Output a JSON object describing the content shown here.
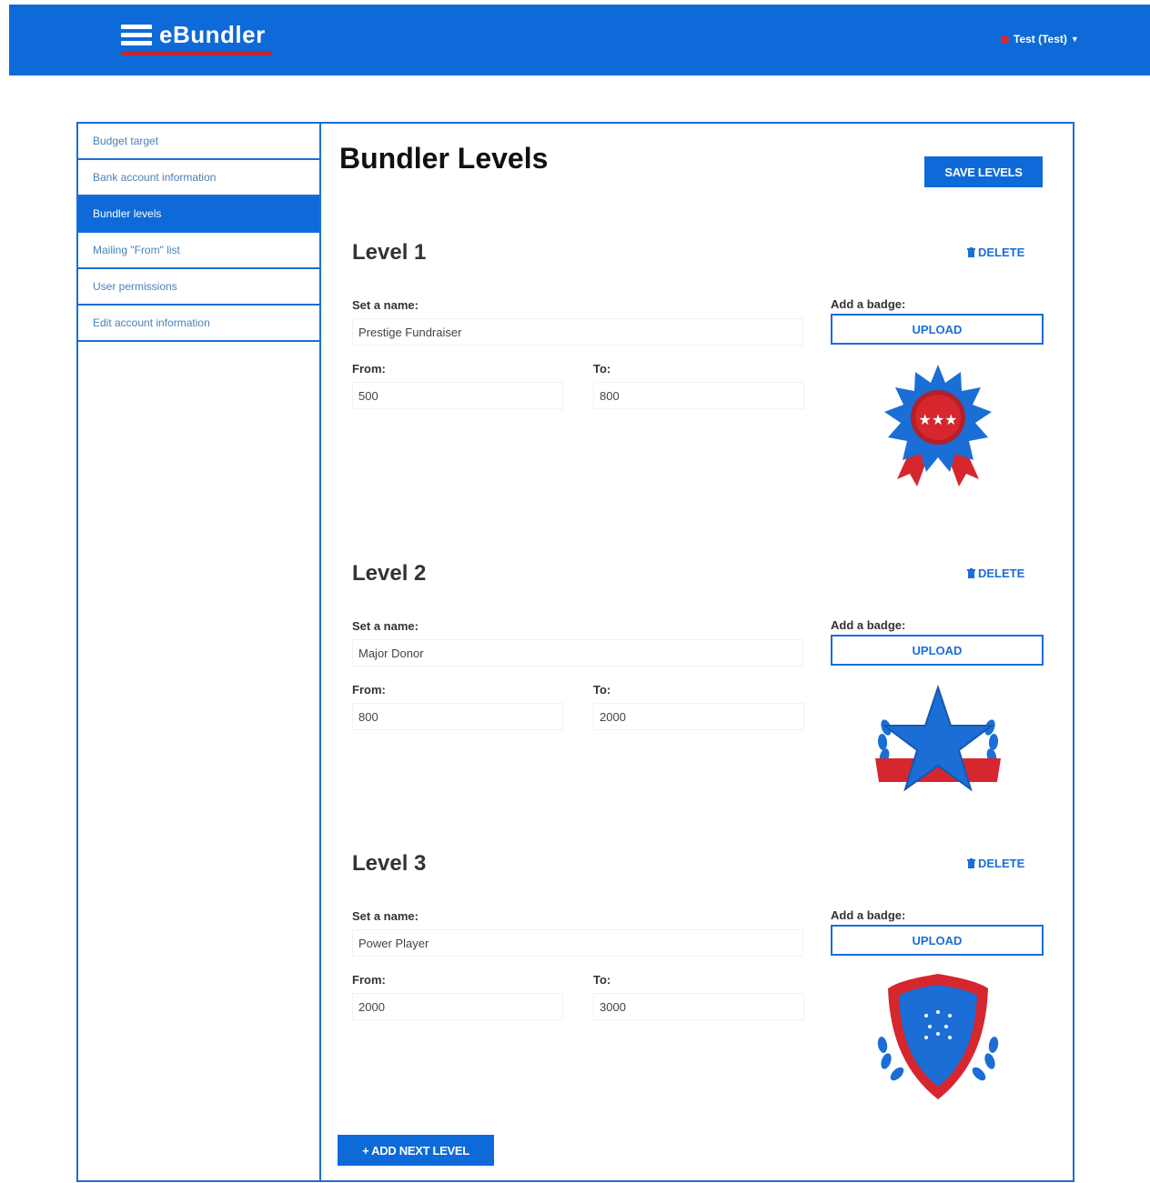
{
  "app": {
    "name": "eBundler"
  },
  "user": {
    "label": "Test (Test)"
  },
  "sidebar": {
    "items": [
      {
        "label": "Budget target"
      },
      {
        "label": "Bank account information"
      },
      {
        "label": "Bundler levels"
      },
      {
        "label": "Mailing \"From\" list"
      },
      {
        "label": "User permissions"
      },
      {
        "label": "Edit account information"
      }
    ]
  },
  "page": {
    "title": "Bundler Levels",
    "save_label": "SAVE LEVELS",
    "add_label": "+ ADD NEXT LEVEL"
  },
  "labels": {
    "name": "Set a name:",
    "from": "From:",
    "to": "To:",
    "badge": "Add a badge:",
    "upload": "UPLOAD",
    "delete": "DELETE"
  },
  "levels": [
    {
      "title": "Level 1",
      "name": "Prestige Fundraiser",
      "from": "500",
      "to": "800",
      "badge_icon": "ribbon-medal-icon"
    },
    {
      "title": "Level 2",
      "name": "Major Donor",
      "from": "800",
      "to": "2000",
      "badge_icon": "star-laurel-icon"
    },
    {
      "title": "Level 3",
      "name": "Power Player",
      "from": "2000",
      "to": "3000",
      "badge_icon": "shield-laurel-icon"
    }
  ],
  "colors": {
    "brand_blue": "#0e6ad8",
    "accent_red": "#c8252c"
  }
}
